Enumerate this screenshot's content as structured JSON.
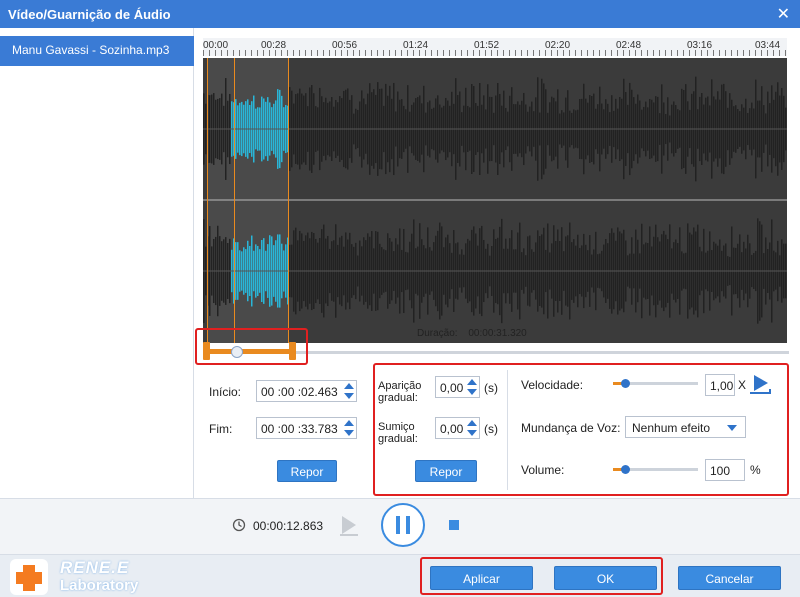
{
  "window": {
    "title": "Vídeo/Guarnição de Áudio",
    "close_icon": "close-icon"
  },
  "sidebar": {
    "file_name": "Manu Gavassi - Sozinha.mp3"
  },
  "ruler": {
    "ticks": [
      "00:00",
      "00:28",
      "00:56",
      "01:24",
      "01:52",
      "02:20",
      "02:48",
      "03:16",
      "03:44"
    ]
  },
  "timeline": {
    "duration_label": "Duração:",
    "duration_value": "00:00:31.320"
  },
  "trim": {
    "start_label": "Início:",
    "start_value": "00 :00 :02.463",
    "end_label": "Fim:",
    "end_value": "00 :00 :33.783",
    "reset_label": "Repor"
  },
  "fade": {
    "fade_in_label": "Aparição gradual:",
    "fade_in_value": "0,00",
    "fade_in_unit": "(s)",
    "fade_out_label": "Sumiço gradual:",
    "fade_out_value": "0,00",
    "fade_out_unit": "(s)",
    "reset_label": "Repor"
  },
  "effects": {
    "speed_label": "Velocidade:",
    "speed_value": "1,00",
    "speed_unit": "X",
    "voice_label": "Mundança de Voz:",
    "voice_value": "Nenhum efeito",
    "volume_label": "Volume:",
    "volume_value": "100",
    "volume_unit": "%"
  },
  "transport": {
    "current_time": "00:00:12.863"
  },
  "brand": {
    "name": "RENE.E",
    "subtitle": "Laboratory"
  },
  "footer": {
    "apply_label": "Aplicar",
    "ok_label": "OK",
    "cancel_label": "Cancelar"
  },
  "colors": {
    "accent": "#3a7bd5",
    "waveform": "#29b6d8",
    "selection": "#e98a1f",
    "highlight": "#e02020"
  }
}
